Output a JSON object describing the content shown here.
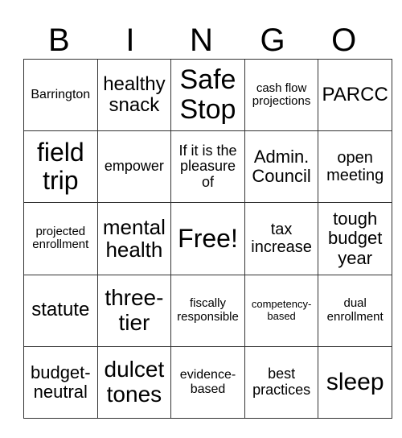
{
  "header": {
    "letters": [
      "B",
      "I",
      "N",
      "G",
      "O"
    ]
  },
  "rows": [
    [
      "Barrington",
      "healthy snack",
      "Safe Stop",
      "cash flow projections",
      "PARCC"
    ],
    [
      "field trip",
      "empower",
      "If it is the pleasure of",
      "Admin. Council",
      "open meeting"
    ],
    [
      "projected enrollment",
      "mental health",
      "Free!",
      "tax increase",
      "tough budget year"
    ],
    [
      "statute",
      "three-tier",
      "fiscally responsible",
      "competency-based",
      "dual enrollment"
    ],
    [
      "budget-neutral",
      "dulcet tones",
      "evidence-based",
      "best practices",
      "sleep"
    ]
  ]
}
